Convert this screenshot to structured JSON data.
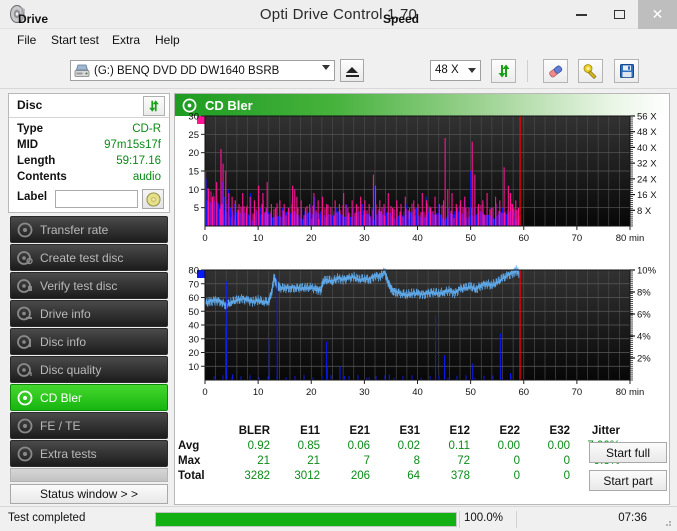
{
  "window": {
    "title": "Opti Drive Control 1.70",
    "icon": "disc-icon",
    "minimize_label": "–",
    "maximize_label": "❑",
    "close_label": "✕"
  },
  "menu": {
    "items": [
      {
        "label": "File",
        "name": "menu-file"
      },
      {
        "label": "Start test",
        "name": "menu-start-test"
      },
      {
        "label": "Extra",
        "name": "menu-extra"
      },
      {
        "label": "Help",
        "name": "menu-help"
      }
    ]
  },
  "toolbar": {
    "drive_label": "Drive",
    "drive_value": "(G:)   BENQ DVD DD DW1640 BSRB",
    "drive_icon": "drive-icon",
    "eject_icon": "eject-icon",
    "speed_label": "Speed",
    "speed_value": "48 X",
    "refresh_icon": "refresh-icon",
    "erase_icon": "erase-icon",
    "settings_icon": "settings-icon",
    "save_icon": "save-icon"
  },
  "disc": {
    "header": "Disc",
    "refresh_icon": "refresh-icon",
    "rows": [
      {
        "key": "Type",
        "value": "CD-R"
      },
      {
        "key": "MID",
        "value": "97m15s17f"
      },
      {
        "key": "Length",
        "value": "59:17.16"
      },
      {
        "key": "Contents",
        "value": "audio"
      }
    ],
    "label_key": "Label",
    "label_value": "",
    "label_icon": "cd-icon"
  },
  "sidebar": {
    "items": [
      {
        "label": "Transfer rate",
        "name": "sidebar-item-transfer-rate",
        "icon": "disc-icon",
        "active": false
      },
      {
        "label": "Create test disc",
        "name": "sidebar-item-create-test-disc",
        "icon": "disc-icon",
        "active": false
      },
      {
        "label": "Verify test disc",
        "name": "sidebar-item-verify-test-disc",
        "icon": "disc-icon",
        "active": false
      },
      {
        "label": "Drive info",
        "name": "sidebar-item-drive-info",
        "icon": "disc-icon",
        "active": false
      },
      {
        "label": "Disc info",
        "name": "sidebar-item-disc-info",
        "icon": "disc-icon",
        "active": false
      },
      {
        "label": "Disc quality",
        "name": "sidebar-item-disc-quality",
        "icon": "disc-icon",
        "active": false
      },
      {
        "label": "CD Bler",
        "name": "sidebar-item-cd-bler",
        "icon": "disc-icon",
        "active": true
      },
      {
        "label": "FE / TE",
        "name": "sidebar-item-fe-te",
        "icon": "disc-icon",
        "active": false
      },
      {
        "label": "Extra tests",
        "name": "sidebar-item-extra-tests",
        "icon": "disc-icon",
        "active": false
      }
    ],
    "status_window_label": "Status window > >"
  },
  "main": {
    "header": "CD Bler",
    "header_icon": "disc-icon",
    "start_full_label": "Start full",
    "start_part_label": "Start part"
  },
  "statusbar": {
    "status_text": "Test completed",
    "progress_percent": 100.0,
    "progress_label": "100.0%",
    "elapsed": "07:36"
  },
  "stats": {
    "columns": [
      "BLER",
      "E11",
      "E21",
      "E31",
      "E12",
      "E22",
      "E32",
      "Jitter"
    ],
    "rows": [
      {
        "label": "Avg",
        "values": [
          "0.92",
          "0.85",
          "0.06",
          "0.02",
          "0.11",
          "0.00",
          "0.00",
          "7.90%"
        ]
      },
      {
        "label": "Max",
        "values": [
          "21",
          "21",
          "7",
          "8",
          "72",
          "0",
          "0",
          "9.8%"
        ]
      },
      {
        "label": "Total",
        "values": [
          "3282",
          "3012",
          "206",
          "64",
          "378",
          "0",
          "0",
          ""
        ]
      }
    ]
  },
  "colors": {
    "bler": "#ff1493",
    "e11": "#0b19f5",
    "e21": "#b01ce8",
    "e31": "#8a22e0",
    "e12": "#0b19f5",
    "e22": "#a020f0",
    "e32": "#ff1493",
    "jitter": "#4d7a7a",
    "jitter_line": "#5fa8e8",
    "marker": "#f20000",
    "accent_green": "#17b510",
    "value_green": "#0a8a18"
  },
  "chart_data": [
    {
      "type": "line",
      "name": "cd-bler-errors-chart",
      "title": "",
      "xlabel": "min",
      "ylabel": "",
      "xlim": [
        0,
        80
      ],
      "xticks": [
        0,
        10,
        20,
        30,
        40,
        50,
        60,
        70,
        80
      ],
      "xticklabels": [
        "0",
        "10",
        "20",
        "30",
        "40",
        "50",
        "60",
        "70",
        "80 min"
      ],
      "ylim": [
        0,
        30
      ],
      "yticks": [
        5,
        10,
        15,
        20,
        25,
        30
      ],
      "yticklabels": [
        "5",
        "10",
        "15",
        "20",
        "25",
        "30"
      ],
      "y2lim": [
        0,
        56
      ],
      "y2ticks": [
        8,
        16,
        24,
        32,
        40,
        48,
        56
      ],
      "y2ticklabels": [
        "8 X",
        "16 X",
        "24 X",
        "32 X",
        "40 X",
        "48 X",
        "56 X"
      ],
      "grid": true,
      "legend": [
        {
          "label": "BLER",
          "color": "#ff1493"
        },
        {
          "label": "E11",
          "color": "#0b19f5"
        },
        {
          "label": "E21",
          "color": "#b01ce8"
        },
        {
          "label": "E31",
          "color": "#8a22e0"
        }
      ],
      "data_end_min": 59.3,
      "marker_min": 59.3,
      "series": [
        {
          "name": "E11",
          "color": "#0b19f5",
          "x": [
            0.2,
            0.5,
            0.9,
            1.2,
            1.6,
            2.0,
            2.4,
            2.8,
            3.1,
            3.3,
            3.6,
            4.0,
            4.4,
            4.8,
            5.2,
            5.6,
            6.0,
            6.5,
            7.0,
            7.5,
            8.0,
            8.6,
            9.2,
            9.8,
            10.4,
            11.0,
            11.6,
            12.2,
            12.8,
            13.4,
            14.0,
            14.6,
            15.2,
            15.8,
            16.4,
            17.0,
            17.6,
            18.2,
            18.8,
            19.4,
            20.0,
            20.6,
            21.2,
            21.8,
            22.4,
            23.0,
            23.6,
            24.2,
            24.8,
            25.4,
            26.0,
            26.6,
            27.2,
            27.8,
            28.4,
            29.0,
            29.6,
            30.2,
            30.8,
            31.4,
            32.0,
            32.6,
            33.2,
            33.8,
            34.4,
            35.0,
            35.6,
            36.2,
            36.8,
            37.4,
            38.0,
            38.6,
            39.2,
            39.8,
            40.4,
            41.0,
            41.6,
            42.2,
            42.8,
            43.4,
            44.0,
            44.6,
            45.2,
            45.8,
            46.4,
            47.0,
            47.6,
            48.2,
            48.8,
            49.4,
            50.0,
            50.6,
            51.2,
            51.8,
            52.4,
            53.0,
            53.6,
            54.2,
            54.8,
            55.4,
            56.0,
            56.6,
            57.2,
            57.8,
            58.4,
            59.0
          ],
          "y": [
            13,
            7,
            4,
            5,
            9,
            6,
            3,
            5,
            21,
            12,
            8,
            6,
            10,
            5,
            4,
            6,
            3,
            4,
            5,
            3,
            4,
            9,
            3,
            4,
            5,
            7,
            4,
            3,
            2,
            3,
            4,
            5,
            3,
            5,
            8,
            4,
            3,
            5,
            4,
            3,
            6,
            8,
            3,
            4,
            3,
            2,
            3,
            4,
            5,
            3,
            4,
            6,
            3,
            5,
            4,
            3,
            6,
            4,
            3,
            5,
            11,
            4,
            3,
            5,
            4,
            3,
            4,
            5,
            3,
            4,
            6,
            3,
            4,
            5,
            3,
            4,
            8,
            5,
            3,
            4,
            6,
            3,
            4,
            5,
            3,
            4,
            5,
            3,
            7,
            4,
            15,
            5,
            3,
            4,
            6,
            3,
            5,
            4,
            6,
            3,
            5,
            4,
            3,
            6,
            4,
            5
          ]
        },
        {
          "name": "BLER",
          "color": "#ff1493",
          "x": [
            0.1,
            0.7,
            1.4,
            2.2,
            3.0,
            3.4,
            3.9,
            4.5,
            5.1,
            5.7,
            6.4,
            7.1,
            7.8,
            8.5,
            9.3,
            10.1,
            10.9,
            11.7,
            12.5,
            13.3,
            14.1,
            14.9,
            15.7,
            16.5,
            16.9,
            17.3,
            18.1,
            18.9,
            19.7,
            20.5,
            21.3,
            22.1,
            22.9,
            23.7,
            24.5,
            25.3,
            26.1,
            26.9,
            27.7,
            28.5,
            29.3,
            30.1,
            30.9,
            31.7,
            32.1,
            32.9,
            33.7,
            34.5,
            35.3,
            36.1,
            36.9,
            37.7,
            38.5,
            39.3,
            40.1,
            40.9,
            41.7,
            42.5,
            43.3,
            44.1,
            44.9,
            45.2,
            45.7,
            46.5,
            47.3,
            48.1,
            48.9,
            49.7,
            50.3,
            50.8,
            51.5,
            52.3,
            53.1,
            53.9,
            54.7,
            55.5,
            56.3,
            57.1,
            57.5,
            57.9,
            58.5,
            59.0
          ],
          "y": [
            15,
            10,
            8,
            12,
            21,
            17,
            15,
            9,
            8,
            7,
            6,
            9,
            5,
            8,
            7,
            11,
            9,
            12,
            6,
            5,
            7,
            6,
            5,
            11,
            10,
            8,
            7,
            5,
            6,
            9,
            7,
            8,
            6,
            5,
            7,
            6,
            9,
            5,
            7,
            6,
            8,
            7,
            6,
            14,
            11,
            7,
            6,
            9,
            5,
            7,
            6,
            8,
            5,
            7,
            6,
            9,
            7,
            5,
            8,
            6,
            7,
            24,
            10,
            9,
            6,
            7,
            8,
            5,
            23,
            14,
            6,
            7,
            9,
            5,
            8,
            7,
            16,
            11,
            9,
            6,
            7,
            5
          ]
        },
        {
          "name": "E21",
          "color": "#b01ce8",
          "x": [
            3.2,
            11.5,
            16.8,
            25.4,
            33.1,
            41.6,
            50.2,
            57.4
          ],
          "y": [
            6,
            5,
            4,
            3,
            4,
            3,
            5,
            4
          ]
        },
        {
          "name": "E31",
          "color": "#8a22e0",
          "x": [
            3.5,
            20.1,
            38.4,
            52.7
          ],
          "y": [
            3,
            2,
            2,
            3
          ]
        }
      ]
    },
    {
      "type": "line",
      "name": "cd-bler-jitter-chart",
      "title": "",
      "xlabel": "min",
      "ylabel": "",
      "xlim": [
        0,
        80
      ],
      "xticks": [
        0,
        10,
        20,
        30,
        40,
        50,
        60,
        70,
        80
      ],
      "xticklabels": [
        "0",
        "10",
        "20",
        "30",
        "40",
        "50",
        "60",
        "70",
        "80 min"
      ],
      "ylim": [
        0,
        80
      ],
      "yticks": [
        10,
        20,
        30,
        40,
        50,
        60,
        70,
        80
      ],
      "yticklabels": [
        "10",
        "20",
        "30",
        "40",
        "50",
        "60",
        "70",
        "80"
      ],
      "y2lim": [
        0,
        10
      ],
      "y2ticks": [
        2,
        4,
        6,
        8,
        10
      ],
      "y2ticklabels": [
        "2%",
        "4%",
        "6%",
        "8%",
        "10%"
      ],
      "grid": true,
      "legend": [
        {
          "label": "E12",
          "color": "#0b19f5"
        },
        {
          "label": "E22",
          "color": "#a020f0"
        },
        {
          "label": "E32",
          "color": "#ff1493"
        },
        {
          "label": "Jitter",
          "color": "#4d7a7a"
        }
      ],
      "data_end_min": 59.3,
      "marker_min": 59.3,
      "series": [
        {
          "name": "Jitter",
          "color": "#5fa8e8",
          "x": [
            0.2,
            1.0,
            2.0,
            3.0,
            4.0,
            5.0,
            6.0,
            7.0,
            8.0,
            9.0,
            10.0,
            11.0,
            12.0,
            12.6,
            13.0,
            13.4,
            13.7,
            14.0,
            15.0,
            16.0,
            17.0,
            18.0,
            19.0,
            20.0,
            21.0,
            21.8,
            22.2,
            23.0,
            24.0,
            25.0,
            26.0,
            27.0,
            28.0,
            29.0,
            30.0,
            31.0,
            32.0,
            33.0,
            33.8,
            34.3,
            34.8,
            35.3,
            36.0,
            37.0,
            38.0,
            39.0,
            40.0,
            41.0,
            42.0,
            43.0,
            44.0,
            45.0,
            46.0,
            47.0,
            48.0,
            49.0,
            50.0,
            51.0,
            52.0,
            53.0,
            54.0,
            55.0,
            56.0,
            57.0,
            58.0,
            58.6,
            59.2
          ],
          "y": [
            56,
            57,
            58,
            57,
            54,
            57,
            58,
            59,
            58,
            57,
            58,
            57,
            57,
            65,
            75,
            70,
            68,
            67,
            67,
            67,
            67,
            67,
            67,
            67,
            66,
            65,
            72,
            73,
            72,
            74,
            73,
            74,
            75,
            73,
            74,
            73,
            76,
            75,
            79,
            72,
            68,
            65,
            64,
            63,
            62,
            63,
            63,
            62,
            63,
            64,
            63,
            64,
            65,
            63,
            66,
            67,
            68,
            66,
            69,
            70,
            69,
            71,
            74,
            76,
            78,
            80,
            77
          ]
        },
        {
          "name": "E12",
          "color": "#0b19f5",
          "x": [
            3.9,
            4.1,
            5.2,
            12.1,
            13.6,
            22.9,
            23.0,
            25.4,
            26.3,
            30.9,
            34.7,
            43.4,
            45.1,
            50.4,
            55.6,
            57.5
          ],
          "y": [
            39,
            72,
            4,
            30,
            75,
            28,
            10,
            10,
            3,
            2,
            4,
            47,
            18,
            12,
            34,
            5
          ]
        },
        {
          "name": "E22",
          "color": "#a020f0",
          "x": [],
          "y": []
        },
        {
          "name": "E32",
          "color": "#ff1493",
          "x": [],
          "y": []
        }
      ]
    }
  ]
}
